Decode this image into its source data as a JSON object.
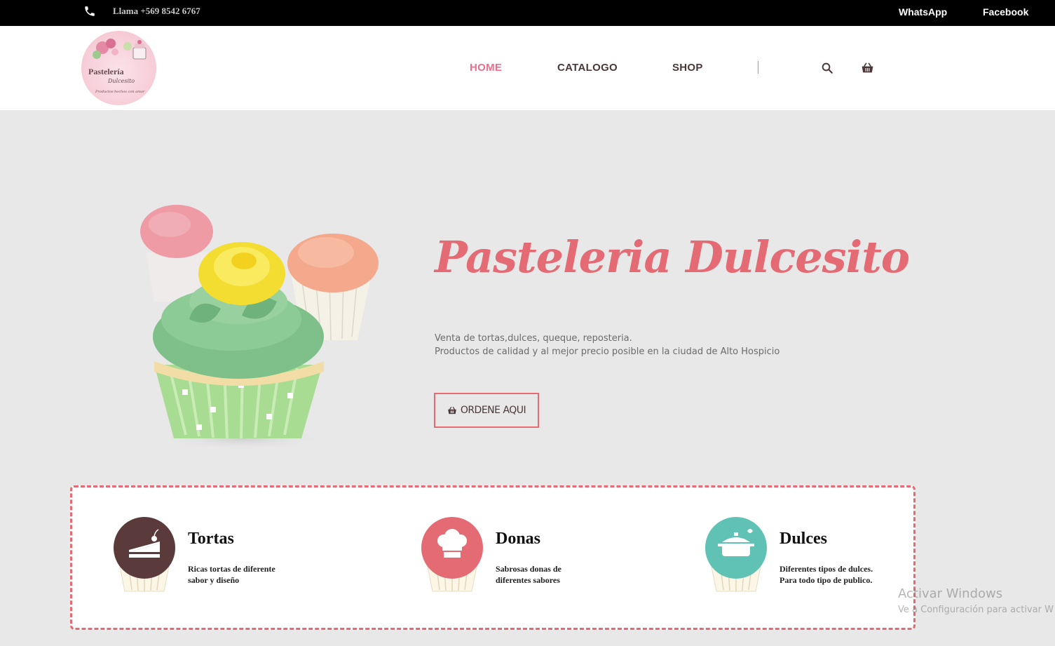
{
  "topbar": {
    "phone_text": "Llama +569 8542 6767",
    "whatsapp_label": "WhatsApp",
    "facebook_label": "Facebook"
  },
  "logo": {
    "line1": "Pastelería",
    "line2": "Dulcesito",
    "line3": "Productos hechos con amor"
  },
  "nav": {
    "home": "HOME",
    "catalogo": "CATALOGO",
    "shop": "SHOP",
    "active_color": "#ee6d8c"
  },
  "hero": {
    "title": "Pasteleria Dulcesito",
    "desc_line1": "Venta de tortas,dulces, queque, reposteria.",
    "desc_line2": "Productos de calidad y al mejor precio posible en la ciudad de Alto Hospicio",
    "order_button": "ORDENE AQUI"
  },
  "features": [
    {
      "title": "Tortas",
      "line1": "Ricas tortas de diferente",
      "line2": "sabor y diseño",
      "icon": "cake-slice-icon",
      "color": "#5a3a3a"
    },
    {
      "title": "Donas",
      "line1": "Sabrosas donas de",
      "line2": "diferentes sabores",
      "icon": "chef-hat-icon",
      "color": "#e46a73"
    },
    {
      "title": "Dulces",
      "line1": "Diferentes tipos de dulces.",
      "line2": "Para todo tipo de publico.",
      "icon": "cooking-pot-icon",
      "color": "#5fc2b5"
    }
  ],
  "watermark": {
    "line1": "Activar Windows",
    "line2": "Ve a Configuración para activar W"
  },
  "colors": {
    "accent": "#e46a73",
    "topbar": "#000000",
    "hero_bg": "#e8e8e8"
  }
}
